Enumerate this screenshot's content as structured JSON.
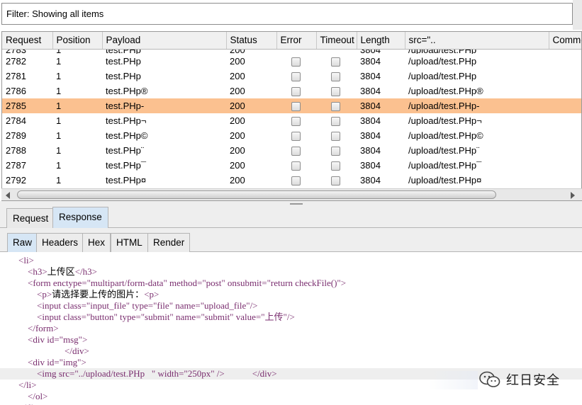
{
  "filter": {
    "text": "Filter: Showing all items"
  },
  "table": {
    "columns": [
      "Request",
      "Position",
      "Payload",
      "Status",
      "Error",
      "Timeout",
      "Length",
      "src=\"..",
      "Comme"
    ],
    "partial_row": {
      "request": "2783",
      "position": "1",
      "payload": "test.PHp\u0010",
      "status": "200",
      "length": "3804",
      "src": "/upload/test.PHp\u0010"
    },
    "rows": [
      {
        "request": "2782",
        "position": "1",
        "payload": "test.PHp\u0011",
        "status": "200",
        "length": "3804",
        "src": "/upload/test.PHp\u0011",
        "selected": false
      },
      {
        "request": "2781",
        "position": "1",
        "payload": "test.PHp\u0012",
        "status": "200",
        "length": "3804",
        "src": "/upload/test.PHp\u0012",
        "selected": false
      },
      {
        "request": "2786",
        "position": "1",
        "payload": "test.PHp®",
        "status": "200",
        "length": "3804",
        "src": "/upload/test.PHp®",
        "selected": false
      },
      {
        "request": "2785",
        "position": "1",
        "payload": "test.PHp-",
        "status": "200",
        "length": "3804",
        "src": "/upload/test.PHp-",
        "selected": true
      },
      {
        "request": "2784",
        "position": "1",
        "payload": "test.PHp¬",
        "status": "200",
        "length": "3804",
        "src": "/upload/test.PHp¬",
        "selected": false
      },
      {
        "request": "2789",
        "position": "1",
        "payload": "test.PHp©",
        "status": "200",
        "length": "3804",
        "src": "/upload/test.PHp©",
        "selected": false
      },
      {
        "request": "2788",
        "position": "1",
        "payload": "test.PHp¨",
        "status": "200",
        "length": "3804",
        "src": "/upload/test.PHp¨",
        "selected": false
      },
      {
        "request": "2787",
        "position": "1",
        "payload": "test.PHp¯",
        "status": "200",
        "length": "3804",
        "src": "/upload/test.PHp¯",
        "selected": false
      },
      {
        "request": "2792",
        "position": "1",
        "payload": "test.PHp¤",
        "status": "200",
        "length": "3804",
        "src": "/upload/test.PHp¤",
        "selected": false
      }
    ]
  },
  "tabs": {
    "request": "Request",
    "response": "Response",
    "active": "Response"
  },
  "subtabs": {
    "raw": "Raw",
    "headers": "Headers",
    "hex": "Hex",
    "html": "HTML",
    "render": "Render",
    "active": "Raw"
  },
  "code_lines": [
    [
      [
        "tag",
        "        <li>"
      ]
    ],
    [
      [
        "tag",
        "            <h3>"
      ],
      [
        "txt",
        "上传区"
      ],
      [
        "tag",
        "</h3>"
      ]
    ],
    [
      [
        "tag",
        "            <form "
      ],
      [
        "attr",
        "enctype="
      ],
      [
        "val",
        "\"multipart/form-data\""
      ],
      [
        "attr",
        " method="
      ],
      [
        "val",
        "\"post\""
      ],
      [
        "attr",
        " onsubmit="
      ],
      [
        "val",
        "\"return checkFile()\""
      ],
      [
        "tag",
        ">"
      ]
    ],
    [
      [
        "tag",
        "                <p>"
      ],
      [
        "txt",
        "请选择要上传的图片："
      ],
      [
        "tag",
        "<p>"
      ]
    ],
    [
      [
        "tag",
        "                <input "
      ],
      [
        "attr",
        "class="
      ],
      [
        "val",
        "\"input_file\""
      ],
      [
        "attr",
        " type="
      ],
      [
        "val",
        "\"file\""
      ],
      [
        "attr",
        " name="
      ],
      [
        "val",
        "\"upload_file\""
      ],
      [
        "tag",
        "/>"
      ]
    ],
    [
      [
        "tag",
        "                <input "
      ],
      [
        "attr",
        "class="
      ],
      [
        "val",
        "\"button\""
      ],
      [
        "attr",
        " type="
      ],
      [
        "val",
        "\"submit\""
      ],
      [
        "attr",
        " name="
      ],
      [
        "val",
        "\"submit\""
      ],
      [
        "attr",
        " value="
      ],
      [
        "val",
        "\"上传\""
      ],
      [
        "tag",
        "/>"
      ]
    ],
    [
      [
        "tag",
        "            </form>"
      ]
    ],
    [
      [
        "tag",
        "            <div "
      ],
      [
        "attr",
        "id="
      ],
      [
        "val",
        "\"msg\""
      ],
      [
        "tag",
        ">"
      ]
    ],
    [
      [
        "tag",
        "                            </div>"
      ]
    ],
    [
      [
        "tag",
        "            <div "
      ],
      [
        "attr",
        "id="
      ],
      [
        "val",
        "\"img\""
      ],
      [
        "tag",
        ">"
      ]
    ],
    [
      [
        "tag",
        "                <img "
      ],
      [
        "attr",
        "src="
      ],
      [
        "val",
        "\"../upload/test.PHp   \""
      ],
      [
        "attr",
        " width="
      ],
      [
        "val",
        "\"250px\""
      ],
      [
        "tag",
        " />"
      ],
      [
        "txt",
        "            "
      ],
      [
        "tag",
        "</div>"
      ]
    ],
    [
      [
        "tag",
        "        </li>"
      ]
    ],
    [
      [
        "tag",
        "            </ol>"
      ]
    ],
    [
      [
        "tag",
        "        </div>"
      ]
    ]
  ],
  "highlight_line": 10,
  "watermark": {
    "text": "红日安全",
    "icon": "wechat-icon"
  },
  "colors": {
    "selected_row": "#fbc190",
    "active_tab": "#d6e6f5",
    "code_tag": "#7a2e6f"
  }
}
